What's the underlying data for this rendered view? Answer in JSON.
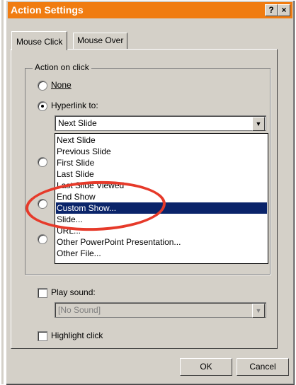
{
  "window": {
    "title": "Action Settings",
    "help_button": "?",
    "close_button": "×",
    "title_color": "#f07c11"
  },
  "tabs": [
    {
      "label": "Mouse Click",
      "active": true
    },
    {
      "label": "Mouse Over",
      "active": false
    }
  ],
  "group": {
    "label": "Action on click",
    "options": [
      {
        "label": "None",
        "selected": false
      },
      {
        "label": "Hyperlink to:",
        "selected": true
      }
    ],
    "hyperlink_value": "Next Slide"
  },
  "dropdown": {
    "items": [
      "Next Slide",
      "Previous Slide",
      "First Slide",
      "Last Slide",
      "Last Slide Viewed",
      "End Show",
      "Custom Show...",
      "Slide...",
      "URL...",
      "Other PowerPoint Presentation...",
      "Other File..."
    ],
    "selected_item": "Custom Show..."
  },
  "sound": {
    "checkbox_label": "Play sound:",
    "value": "[No Sound]"
  },
  "highlight": {
    "checkbox_label": "Highlight click"
  },
  "buttons": {
    "ok": "OK",
    "cancel": "Cancel"
  },
  "annotation_color": "#e63a2a"
}
